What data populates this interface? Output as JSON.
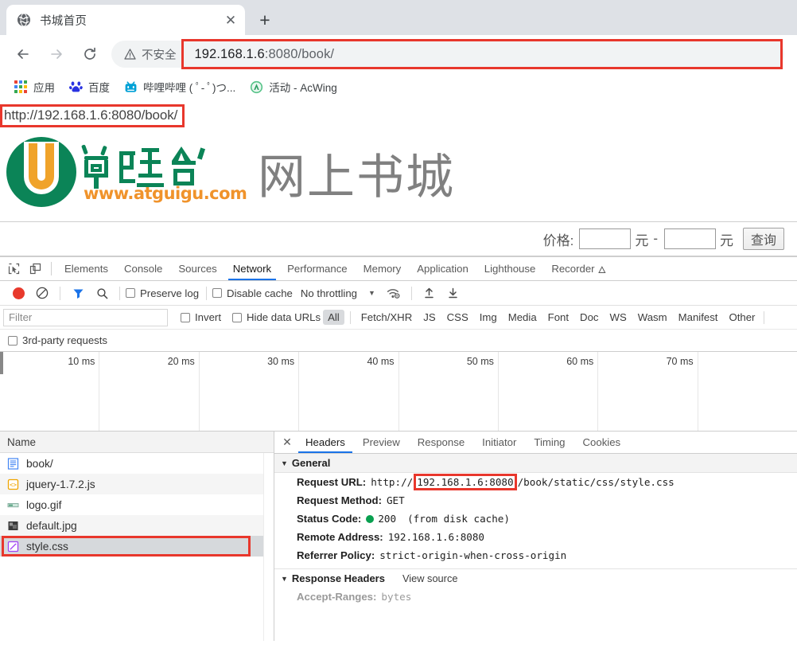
{
  "browser": {
    "tab": {
      "title": "书城首页",
      "favicon": "globe-icon",
      "close_label": "✕"
    },
    "new_tab_label": "+",
    "nav": {
      "back": "←",
      "forward": "→",
      "reload": "⟳"
    },
    "omnibox": {
      "security_label": "不安全",
      "security_icon": "warning-triangle-icon",
      "url_host": "192.168.1.6",
      "url_rest": ":8080/book/",
      "url_full": "192.168.1.6:8080/book/"
    },
    "bookmarks": [
      {
        "label": "应用",
        "icon": "apps-grid-icon"
      },
      {
        "label": "百度",
        "icon": "baidu-icon"
      },
      {
        "label": "哔哩哔哩 ( ﾟ- ﾟ)つ...",
        "icon": "bilibili-icon"
      },
      {
        "label": "活动 - AcWing",
        "icon": "acwing-icon"
      }
    ]
  },
  "page": {
    "annotated_url": "http://192.168.1.6:8080/book/",
    "logo": {
      "brand_cn": "尚硅谷",
      "brand_url": "www.atguigu.com",
      "green": "#0b8457",
      "orange": "#f0a32a"
    },
    "site_title": "网上书城",
    "search": {
      "price_label": "价格:",
      "min_value": "",
      "max_value": "",
      "unit": "元",
      "dash": "-",
      "button_label": "查询"
    }
  },
  "devtools": {
    "left_icons": [
      "inspect-element-icon",
      "device-toolbar-icon"
    ],
    "panels": [
      {
        "label": "Elements",
        "active": false
      },
      {
        "label": "Console",
        "active": false
      },
      {
        "label": "Sources",
        "active": false
      },
      {
        "label": "Network",
        "active": true
      },
      {
        "label": "Performance",
        "active": false
      },
      {
        "label": "Memory",
        "active": false
      },
      {
        "label": "Application",
        "active": false
      },
      {
        "label": "Lighthouse",
        "active": false
      },
      {
        "label": "Recorder",
        "active": false,
        "suffix": "🜂"
      }
    ],
    "network_toolbar": {
      "record_icon": "record-dot-icon",
      "clear_icon": "clear-no-entry-icon",
      "filter_icon": "funnel-icon",
      "search_icon": "magnifier-icon",
      "preserve_log": "Preserve log",
      "disable_cache": "Disable cache",
      "throttling": "No throttling",
      "wifi_icon": "network-conditions-icon",
      "import_icon": "import-har-icon",
      "export_icon": "export-har-icon"
    },
    "filter_bar": {
      "filter_placeholder": "Filter",
      "filter_value": "",
      "invert": "Invert",
      "hide_data_urls": "Hide data URLs",
      "types": [
        "All",
        "Fetch/XHR",
        "JS",
        "CSS",
        "Img",
        "Media",
        "Font",
        "Doc",
        "WS",
        "Wasm",
        "Manifest",
        "Other"
      ],
      "selected_type": "All",
      "third_party": "3rd-party requests"
    },
    "overview": {
      "ticks": [
        "10 ms",
        "20 ms",
        "30 ms",
        "40 ms",
        "50 ms",
        "60 ms",
        "70 ms"
      ]
    },
    "requests": {
      "column_header": "Name",
      "rows": [
        {
          "name": "book/",
          "icon": "document-icon",
          "selected": false
        },
        {
          "name": "jquery-1.7.2.js",
          "icon": "script-icon",
          "selected": false
        },
        {
          "name": "logo.gif",
          "icon": "image-icon",
          "selected": false
        },
        {
          "name": "default.jpg",
          "icon": "image-icon",
          "selected": false
        },
        {
          "name": "style.css",
          "icon": "stylesheet-icon",
          "selected": true
        }
      ]
    },
    "detail": {
      "close_label": "✕",
      "tabs": [
        {
          "label": "Headers",
          "active": true
        },
        {
          "label": "Preview",
          "active": false
        },
        {
          "label": "Response",
          "active": false
        },
        {
          "label": "Initiator",
          "active": false
        },
        {
          "label": "Timing",
          "active": false
        },
        {
          "label": "Cookies",
          "active": false
        }
      ],
      "general": {
        "section_title": "General",
        "request_url_key": "Request URL:",
        "request_url_prefix": "http://",
        "request_url_host": "192.168.1.6:8080",
        "request_url_path": "/book/static/css/style.css",
        "request_method_key": "Request Method:",
        "request_method_value": "GET",
        "status_code_key": "Status Code:",
        "status_code_value": "200",
        "status_code_note": "(from disk cache)",
        "remote_address_key": "Remote Address:",
        "remote_address_value": "192.168.1.6:8080",
        "referrer_policy_key": "Referrer Policy:",
        "referrer_policy_value": "strict-origin-when-cross-origin"
      },
      "response_headers": {
        "section_title": "Response Headers",
        "view_source": "View source",
        "first_header_key": "Accept-Ranges:",
        "first_header_value": "bytes"
      }
    }
  }
}
